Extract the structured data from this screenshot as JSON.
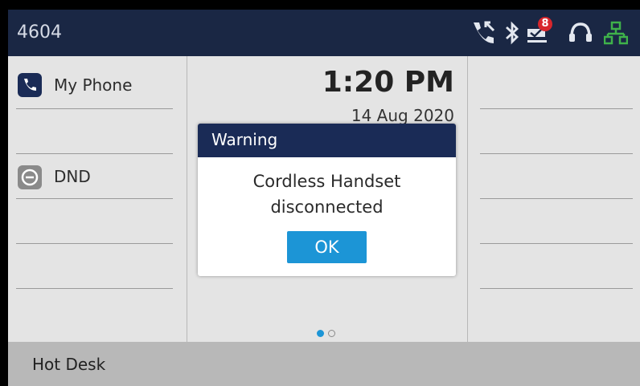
{
  "status_bar": {
    "extension": "4604",
    "voicemail_count": "8",
    "icons": [
      "missed-call-icon",
      "bluetooth-icon",
      "voicemail-icon",
      "headset-icon",
      "network-icon"
    ],
    "accent_color": "#1a2744"
  },
  "left_keys": [
    {
      "label": "My Phone",
      "icon": "phone-icon"
    },
    {
      "label": "DND",
      "icon": "dnd-icon"
    }
  ],
  "clock": {
    "time": "1:20 PM",
    "date": "14 Aug 2020"
  },
  "pagination": {
    "current_page": 1,
    "total_pages": 2
  },
  "dialog": {
    "title": "Warning",
    "message_line1": "Cordless Handset",
    "message_line2": "disconnected",
    "ok_label": "OK",
    "button_color": "#1c95d6"
  },
  "bottom_softkeys": [
    {
      "label": "Hot Desk"
    }
  ]
}
